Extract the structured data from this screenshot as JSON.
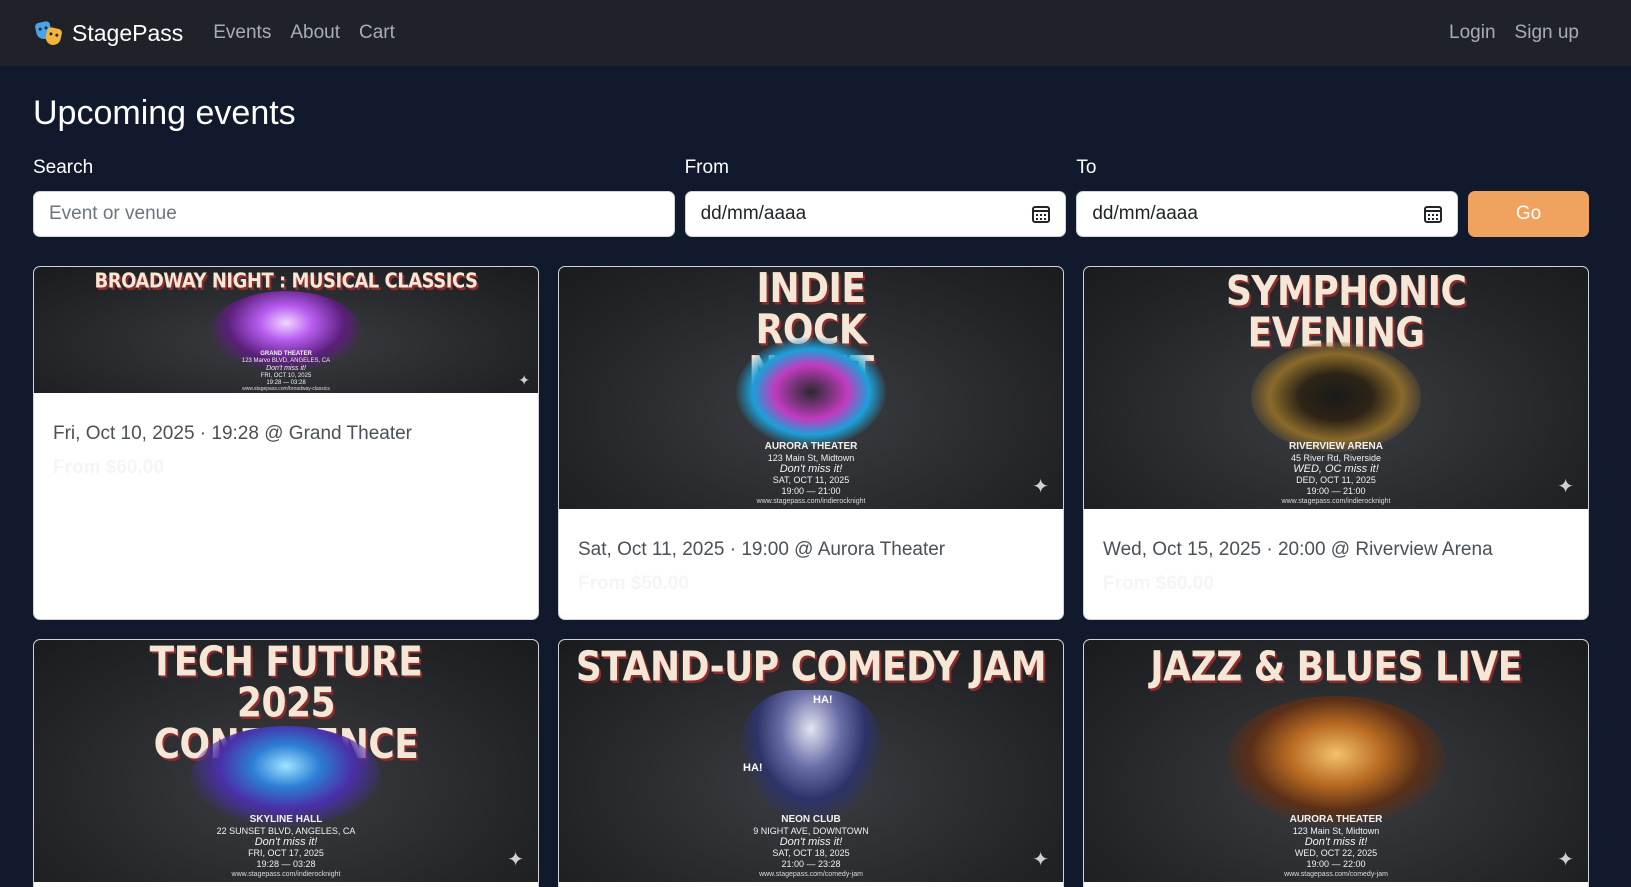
{
  "brand": {
    "name": "StagePass",
    "icon": "theater-masks-icon"
  },
  "nav": {
    "links": [
      "Events",
      "About",
      "Cart"
    ],
    "auth": [
      "Login",
      "Sign up"
    ]
  },
  "page": {
    "title": "Upcoming events"
  },
  "filters": {
    "search_label": "Search",
    "search_placeholder": "Event or venue",
    "from_label": "From",
    "from_value": "dd/mm/aaaa",
    "to_label": "To",
    "to_value": "dd/mm/aaaa",
    "go_label": "Go"
  },
  "colors": {
    "accent": "#f0a35e",
    "background": "#101a2c",
    "navbar": "#1f2329"
  },
  "events": [
    {
      "poster_title": "BROADWAY NIGHT : MUSICAL CLASSICS",
      "poster_venue": "GRAND THEATER",
      "poster_address": "123 Marvo BLVD, ANGELES, CA",
      "poster_tagline": "Don't miss it!",
      "poster_date": "FRI, OCT 10, 2025",
      "poster_time": "19:28 — 03:28",
      "poster_url": "www.stagepass.com/broadway-classics",
      "meta": "Fri, Oct 10, 2025 · 19:28 @ Grand Theater",
      "price": "From $60.00"
    },
    {
      "poster_title": "INDIE ROCK NIGHT",
      "poster_venue": "AURORA THEATER",
      "poster_address": "123 Main St, Midtown",
      "poster_tagline": "Don't miss it!",
      "poster_date": "SAT, OCT 11, 2025",
      "poster_time": "19:00 — 21:00",
      "poster_url": "www.stagepass.com/indierocknight",
      "meta": "Sat, Oct 11, 2025 · 19:00 @ Aurora Theater",
      "price": "From $50.00"
    },
    {
      "poster_title": "SYMPHONIC EVENING",
      "poster_venue": "RIVERVIEW ARENA",
      "poster_address": "45 River Rd, Riverside",
      "poster_tagline": "WED, OC miss it!",
      "poster_date": "DED, OCT 11, 2025",
      "poster_time": "19:00 — 21:00",
      "poster_url": "www.stagepass.com/indierocknight",
      "meta": "Wed, Oct 15, 2025 · 20:00 @ Riverview Arena",
      "price": "From $60.00"
    },
    {
      "poster_title": "TECH FUTURE 2025 CONFERENCE",
      "poster_venue": "SKYLINE HALL",
      "poster_address": "22 SUNSET BLVD, ANGELES, CA",
      "poster_tagline": "Don't miss it!",
      "poster_date": "FRI, OCT 17, 2025",
      "poster_time": "19:28 — 03:28",
      "poster_url": "www.stagepass.com/indierocknight"
    },
    {
      "poster_title": "STAND-UP COMEDY JAM",
      "poster_venue": "NEON CLUB",
      "poster_address": "9 NIGHT AVE, DOWNTOWN",
      "poster_tagline": "Don't miss it!",
      "poster_date": "SAT, OCT 18, 2025",
      "poster_time": "21:00 — 23:28",
      "poster_url": "www.stagepass.com/comedy-jam",
      "speech_1": "HA!",
      "speech_2": "HA!"
    },
    {
      "poster_title": "JAZZ & BLUES LIVE",
      "poster_venue": "AURORA THEATER",
      "poster_address": "123 Main St, Midtown",
      "poster_tagline": "Don't miss it!",
      "poster_date": "WED, OCT 22, 2025",
      "poster_time": "19:00 — 22:00",
      "poster_url": "www.stagepass.com/comedy-jam"
    }
  ]
}
